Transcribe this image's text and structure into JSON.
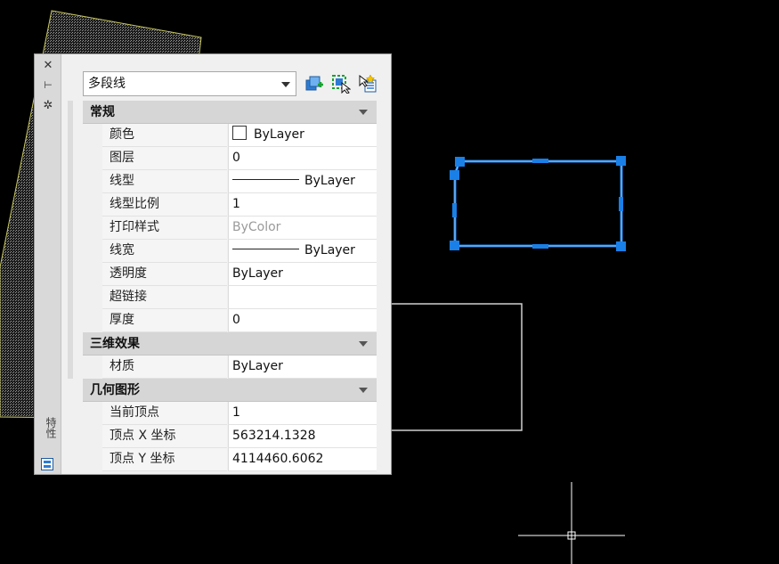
{
  "colors": {
    "canvas_bg": "#000000",
    "selection_blue": "#1a7fe6",
    "grips": "#1a7fe6",
    "drawing_line": "#cfcfcf",
    "hatch_outline": "#c8c860"
  },
  "palette": {
    "title": "特性",
    "object_type": "多段线",
    "toolbar": {
      "toggle_pickadd": "toggle-pickadd-icon",
      "select_objects": "select-objects-icon",
      "quick_select": "quick-select-icon"
    },
    "sections": [
      {
        "title": "常规",
        "rows": [
          {
            "name": "颜色",
            "value": "ByLayer",
            "kind": "color"
          },
          {
            "name": "图层",
            "value": "0"
          },
          {
            "name": "线型",
            "value": "ByLayer",
            "kind": "line"
          },
          {
            "name": "线型比例",
            "value": "1"
          },
          {
            "name": "打印样式",
            "value": "ByColor",
            "dim": true
          },
          {
            "name": "线宽",
            "value": "ByLayer",
            "kind": "line"
          },
          {
            "name": "透明度",
            "value": "ByLayer"
          },
          {
            "name": "超链接",
            "value": ""
          },
          {
            "name": "厚度",
            "value": "0"
          }
        ]
      },
      {
        "title": "三维效果",
        "rows": [
          {
            "name": "材质",
            "value": "ByLayer"
          }
        ]
      },
      {
        "title": "几何图形",
        "rows": [
          {
            "name": "当前顶点",
            "value": "1"
          },
          {
            "name": "顶点 X 坐标",
            "value": "563214.1328"
          },
          {
            "name": "顶点 Y 坐标",
            "value": "4114460.6062"
          }
        ]
      }
    ]
  }
}
